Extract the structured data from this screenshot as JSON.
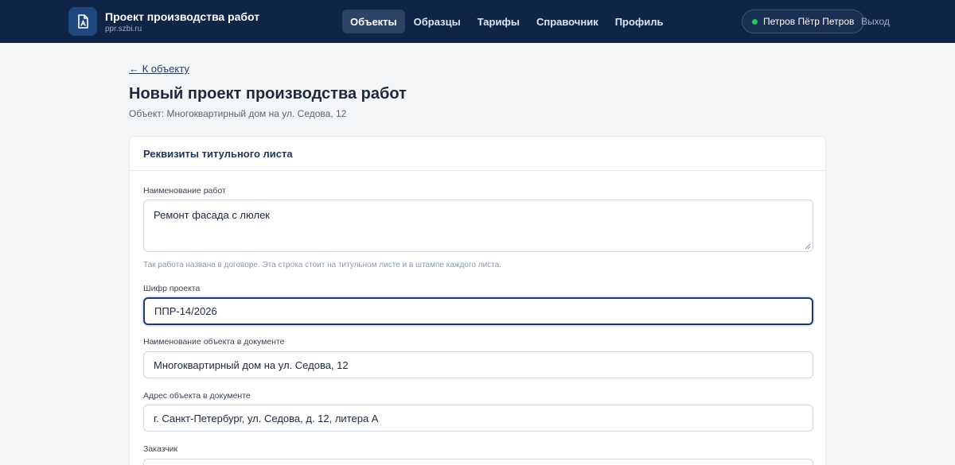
{
  "header": {
    "app_title": "Проект производства работ",
    "app_domain": "ppr.szbi.ru",
    "nav": [
      {
        "label": "Объекты",
        "active": true
      },
      {
        "label": "Образцы",
        "active": false
      },
      {
        "label": "Тарифы",
        "active": false
      },
      {
        "label": "Справочник",
        "active": false
      },
      {
        "label": "Профиль",
        "active": false
      }
    ],
    "user_name": "Петров Пётр Петров",
    "logout_label": "Выход"
  },
  "page": {
    "back_link": "← К объекту",
    "title": "Новый проект производства работ",
    "subtitle": "Объект: Многоквартирный дом на ул. Седова, 12"
  },
  "card": {
    "title": "Реквизиты титульного листа",
    "fields": {
      "work_name": {
        "label": "Наименование работ",
        "value": "Ремонт фасада с люлек",
        "hint": "Так работа названа в договоре. Эта строка стоит на титульном листе и в штампе каждого листа."
      },
      "project_code": {
        "label": "Шифр проекта",
        "value": "ППР-14/2026"
      },
      "object_name": {
        "label": "Наименование объекта в документе",
        "value": "Многоквартирный дом на ул. Седова, 12"
      },
      "object_address": {
        "label": "Адрес объекта в документе",
        "value": "г. Санкт-Петербург, ул. Седова, д. 12, литера А"
      },
      "customer": {
        "label": "Заказчик",
        "value": ""
      }
    }
  },
  "colors": {
    "header_bg": "#0f2546",
    "accent": "#1f3b66",
    "status_online": "#22c55e"
  }
}
